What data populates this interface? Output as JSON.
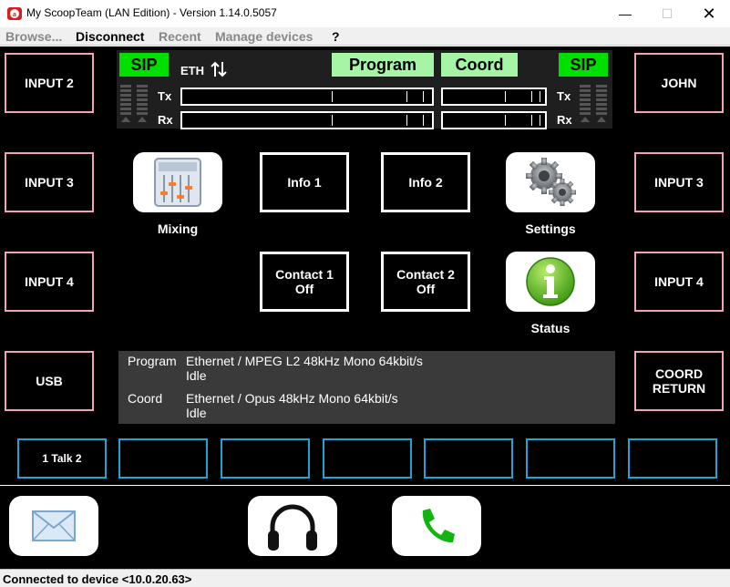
{
  "window": {
    "title": "My ScoopTeam (LAN Edition) - Version 1.14.0.5057",
    "min_symbol": "—",
    "max_symbol": "☐",
    "close_symbol": "✕",
    "app_icon": "aeq-logo-icon"
  },
  "menu": {
    "browse": "Browse...",
    "disconnect": "Disconnect",
    "recent": "Recent",
    "manage": "Manage devices",
    "help": "?"
  },
  "left_inputs": [
    "INPUT 2",
    "INPUT 3",
    "INPUT 4",
    "USB"
  ],
  "right_inputs": [
    "JOHN",
    "INPUT 3",
    "INPUT 4",
    "COORD\nRETURN"
  ],
  "meters": {
    "sip_left": "SIP",
    "sip_right": "SIP",
    "eth": "ETH",
    "eth_icon": "up-down-arrows-icon",
    "program": "Program",
    "coord": "Coord",
    "tx": "Tx",
    "rx": "Rx"
  },
  "controls": {
    "mixing_label": "Mixing",
    "settings_label": "Settings",
    "status_label": "Status",
    "info1": "Info 1",
    "info2": "Info 2",
    "contact1_title": "Contact 1",
    "contact1_state": "Off",
    "contact2_title": "Contact 2",
    "contact2_state": "Off"
  },
  "status_panel": {
    "program_label": "Program",
    "program_codec": "Ethernet / MPEG L2 48kHz Mono 64kbit/s",
    "program_state": "Idle",
    "coord_label": "Coord",
    "coord_codec": "Ethernet / Opus 48kHz Mono 64kbit/s",
    "coord_state": "Idle"
  },
  "talk_buttons": [
    "1 Talk 2",
    "",
    "",
    "",
    "",
    "",
    ""
  ],
  "colors": {
    "sip_green": "#00e000",
    "mode_green": "#a6f5a6",
    "input_border": "#f4a3b6",
    "talk_border": "#1fa3d8"
  },
  "statusbar": {
    "text": "Connected to device <10.0.20.63>"
  }
}
